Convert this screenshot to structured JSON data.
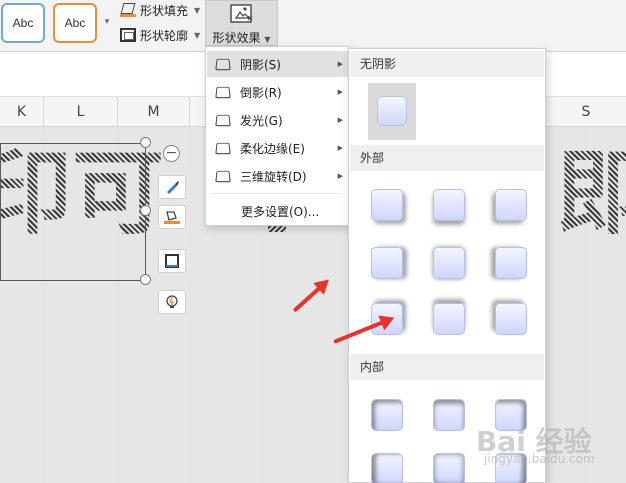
{
  "ribbon": {
    "style1_label": "Abc",
    "style2_label": "Abc",
    "shape_fill_label": "形状填充",
    "shape_outline_label": "形状轮廓",
    "shape_effect_label": "形状效果"
  },
  "columns": [
    "K",
    "L",
    "M",
    "S"
  ],
  "art_text": [
    "印可",
    "即"
  ],
  "menu": {
    "items": [
      {
        "label": "阴影(S)"
      },
      {
        "label": "倒影(R)"
      },
      {
        "label": "发光(G)"
      },
      {
        "label": "柔化边缘(E)"
      },
      {
        "label": "三维旋转(D)"
      }
    ],
    "more_label": "更多设置(O)..."
  },
  "submenu": {
    "no_shadow_label": "无阴影",
    "outer_label": "外部",
    "inner_label": "内部"
  },
  "watermark": {
    "main": "Bai 经验",
    "sub": "jingyan.baidu.com"
  }
}
